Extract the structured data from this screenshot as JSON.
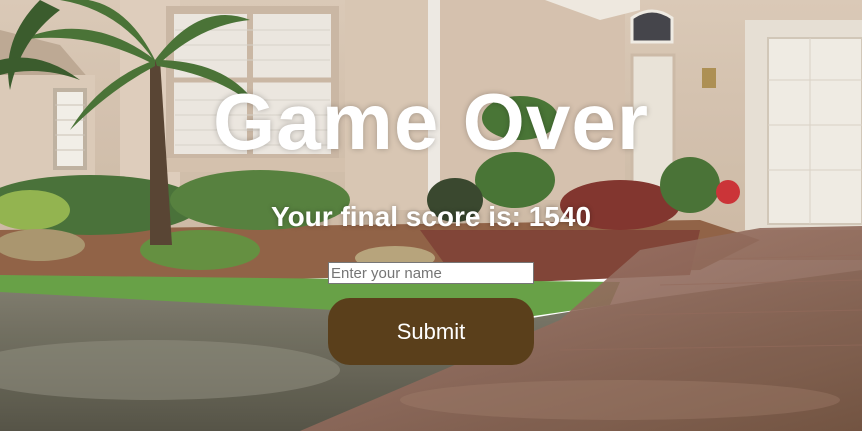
{
  "game_over": {
    "title": "Game Over",
    "score_text": "Your final score is: 1540",
    "name_placeholder": "Enter your name",
    "name_value": "",
    "submit_label": "Submit"
  },
  "colors": {
    "button_background": "#5a3f1b",
    "text": "#ffffff"
  }
}
